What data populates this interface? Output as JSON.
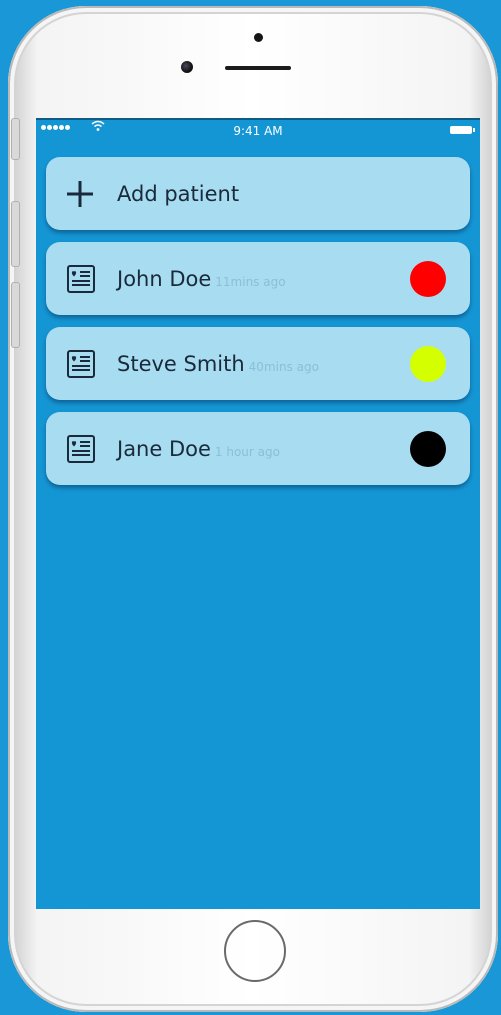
{
  "status_bar": {
    "time": "9:41 AM"
  },
  "add_button": {
    "label": "Add patient"
  },
  "patients": [
    {
      "name": "John Doe",
      "ago": "11mins ago",
      "status_color": "#ff0000"
    },
    {
      "name": "Steve Smith",
      "ago": "40mins ago",
      "status_color": "#d4ff00"
    },
    {
      "name": "Jane Doe",
      "ago": "1 hour ago",
      "status_color": "#000000"
    }
  ],
  "icons": {
    "add": "plus-icon",
    "patient": "medical-record-icon"
  },
  "colors": {
    "background": "#1596d4",
    "card": "#a7dcf1",
    "text": "#1b2a3a"
  }
}
